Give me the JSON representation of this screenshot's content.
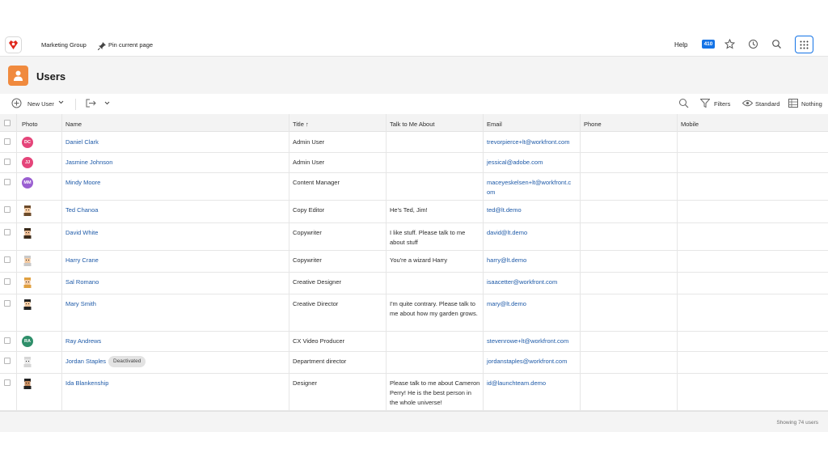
{
  "topbar": {
    "group": "Marketing Group",
    "pin": "Pin current page",
    "help": "Help",
    "notifications": "410"
  },
  "page": {
    "title": "Users"
  },
  "toolbar": {
    "new_user": "New User",
    "filters": "Filters",
    "view": "Standard",
    "grouping": "Nothing"
  },
  "columns": [
    "Photo",
    "Name",
    "Title ↑",
    "Talk to Me About",
    "Email",
    "Phone",
    "Mobile"
  ],
  "colors": {
    "accent": "#1473e6",
    "link": "#1e5aa8",
    "users_tile": "#f08a3e"
  },
  "rows": [
    {
      "avatar": "DC",
      "avatar_color": "#e5457a",
      "name": "Daniel Clark",
      "title": "Admin User",
      "talk": "",
      "email": "trevorpierce+lt@workfront.com"
    },
    {
      "avatar": "JJ",
      "avatar_color": "#e5457a",
      "name": "Jasmine Johnson",
      "title": "Admin User",
      "talk": "",
      "email": "jessical@adobe.com"
    },
    {
      "avatar": "MM",
      "avatar_color": "#9a5fd1",
      "name": "Mindy Moore",
      "title": "Content Manager",
      "talk": "",
      "email": "maceyeskelsen+lt@workfront.c om"
    },
    {
      "avatar": "",
      "avatar_color": "",
      "name": "Ted Chanoa",
      "title": "Copy Editor",
      "talk": "He's Ted, Jim!",
      "email": "ted@lt.demo"
    },
    {
      "avatar": "",
      "avatar_color": "",
      "name": "David White",
      "title": "Copywriter",
      "talk": "I like stuff. Please talk to me about stuff",
      "email": "david@lt.demo"
    },
    {
      "avatar": "",
      "avatar_color": "",
      "name": "Harry Crane",
      "title": "Copywriter",
      "talk": "You're a wizard Harry",
      "email": "harry@lt.demo"
    },
    {
      "avatar": "",
      "avatar_color": "",
      "name": "Sal Romano",
      "title": "Creative Designer",
      "talk": "",
      "email": "isaacetter@workfront.com"
    },
    {
      "avatar": "",
      "avatar_color": "",
      "name": "Mary Smith",
      "title": "Creative Director",
      "talk": "I'm quite contrary. Please talk to me about how my garden grows.",
      "email": "mary@lt.demo"
    },
    {
      "avatar": "RA",
      "avatar_color": "#2f8f6a",
      "name": "Ray Andrews",
      "title": "CX Video Producer",
      "talk": "",
      "email": "stevenrowe+lt@workfront.com"
    },
    {
      "avatar": "",
      "avatar_color": "",
      "name": "Jordan Staples",
      "badge": "Deactivated",
      "title": "Department director",
      "talk": "",
      "email": "jordanstaples@workfront.com"
    },
    {
      "avatar": "",
      "avatar_color": "",
      "name": "Ida Blankenship",
      "title": "Designer",
      "talk": "Please talk to me about Cameron Perry! He is the best person in the whole universe!",
      "email": "id@launchteam.demo"
    }
  ],
  "footer": {
    "count": "Showing 74 users"
  }
}
